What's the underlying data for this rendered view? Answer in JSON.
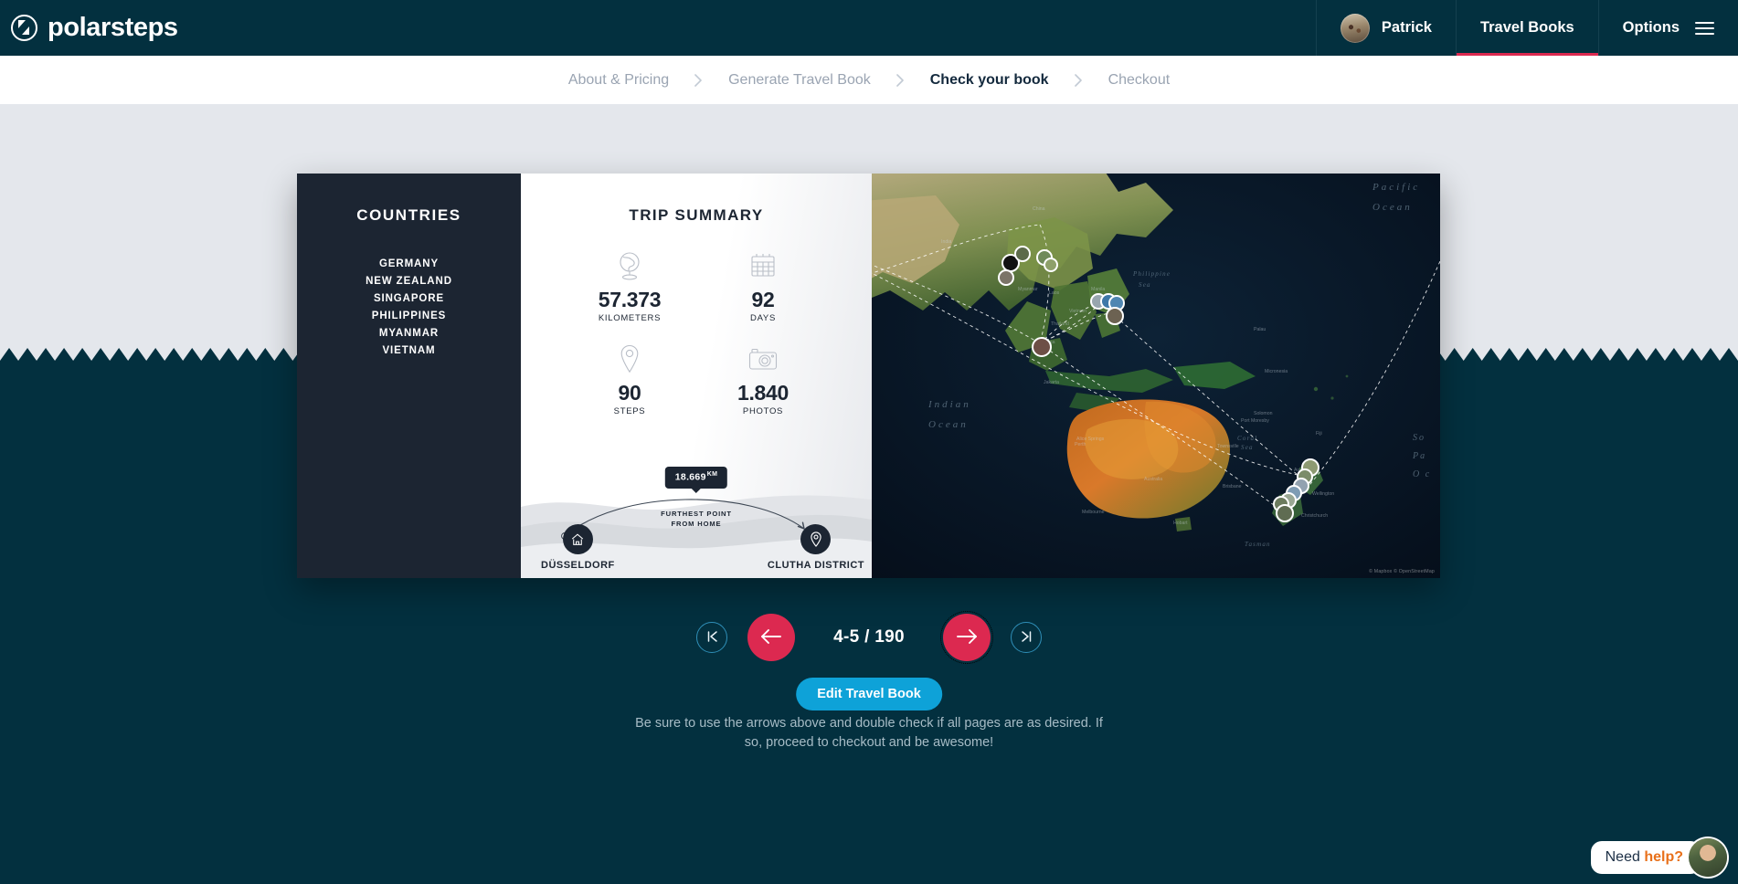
{
  "header": {
    "brand": "polarsteps",
    "brand_icon": "compass-logo-icon",
    "user_name": "Patrick",
    "travel_books_label": "Travel Books",
    "options_label": "Options",
    "menu_icon": "hamburger-icon",
    "accent_active": "#dc2950",
    "background": "#03303f"
  },
  "breadcrumb": {
    "separator_icon": "chevron-right-icon",
    "steps": [
      {
        "label": "About & Pricing",
        "current": false
      },
      {
        "label": "Generate Travel Book",
        "current": false
      },
      {
        "label": "Check your book",
        "current": true
      },
      {
        "label": "Checkout",
        "current": false
      }
    ]
  },
  "book": {
    "countries_page": {
      "title": "COUNTRIES",
      "items": [
        "GERMANY",
        "NEW ZEALAND",
        "SINGAPORE",
        "PHILIPPINES",
        "MYANMAR",
        "VIETNAM"
      ]
    },
    "summary_page": {
      "title": "TRIP SUMMARY",
      "stats": [
        {
          "icon": "globe-icon",
          "value": "57.373",
          "label": "KILOMETERS"
        },
        {
          "icon": "calendar-icon",
          "value": "92",
          "label": "DAYS"
        },
        {
          "icon": "map-pin-icon",
          "value": "90",
          "label": "STEPS"
        },
        {
          "icon": "camera-icon",
          "value": "1.840",
          "label": "PHOTOS"
        }
      ],
      "furthest": {
        "distance_value": "18.669",
        "distance_unit": "KM",
        "caption_line1": "FURTHEST POINT",
        "caption_line2": "FROM HOME",
        "origin": {
          "name": "DÜSSELDORF",
          "icon": "home-icon"
        },
        "destination": {
          "name": "CLUTHA DISTRICT",
          "icon": "map-pin-icon"
        }
      }
    },
    "map_page": {
      "credit": "© Mapbox © OpenStreetMap"
    }
  },
  "pager": {
    "first_icon": "skip-to-first-icon",
    "prev_icon": "arrow-left-icon",
    "next_icon": "arrow-right-icon",
    "last_icon": "skip-to-last-icon",
    "page_counter": "4-5 / 190",
    "accent": "#dc2950"
  },
  "actions": {
    "edit_label": "Edit Travel Book",
    "edit_color": "#0ea2d8",
    "hint": "Be sure to use the arrows above and double check if all pages are as desired. If so, proceed to checkout and be awesome!"
  },
  "help_widget": {
    "text_plain": "Need ",
    "text_bold": "help?",
    "avatar_icon": "support-agent-avatar"
  }
}
